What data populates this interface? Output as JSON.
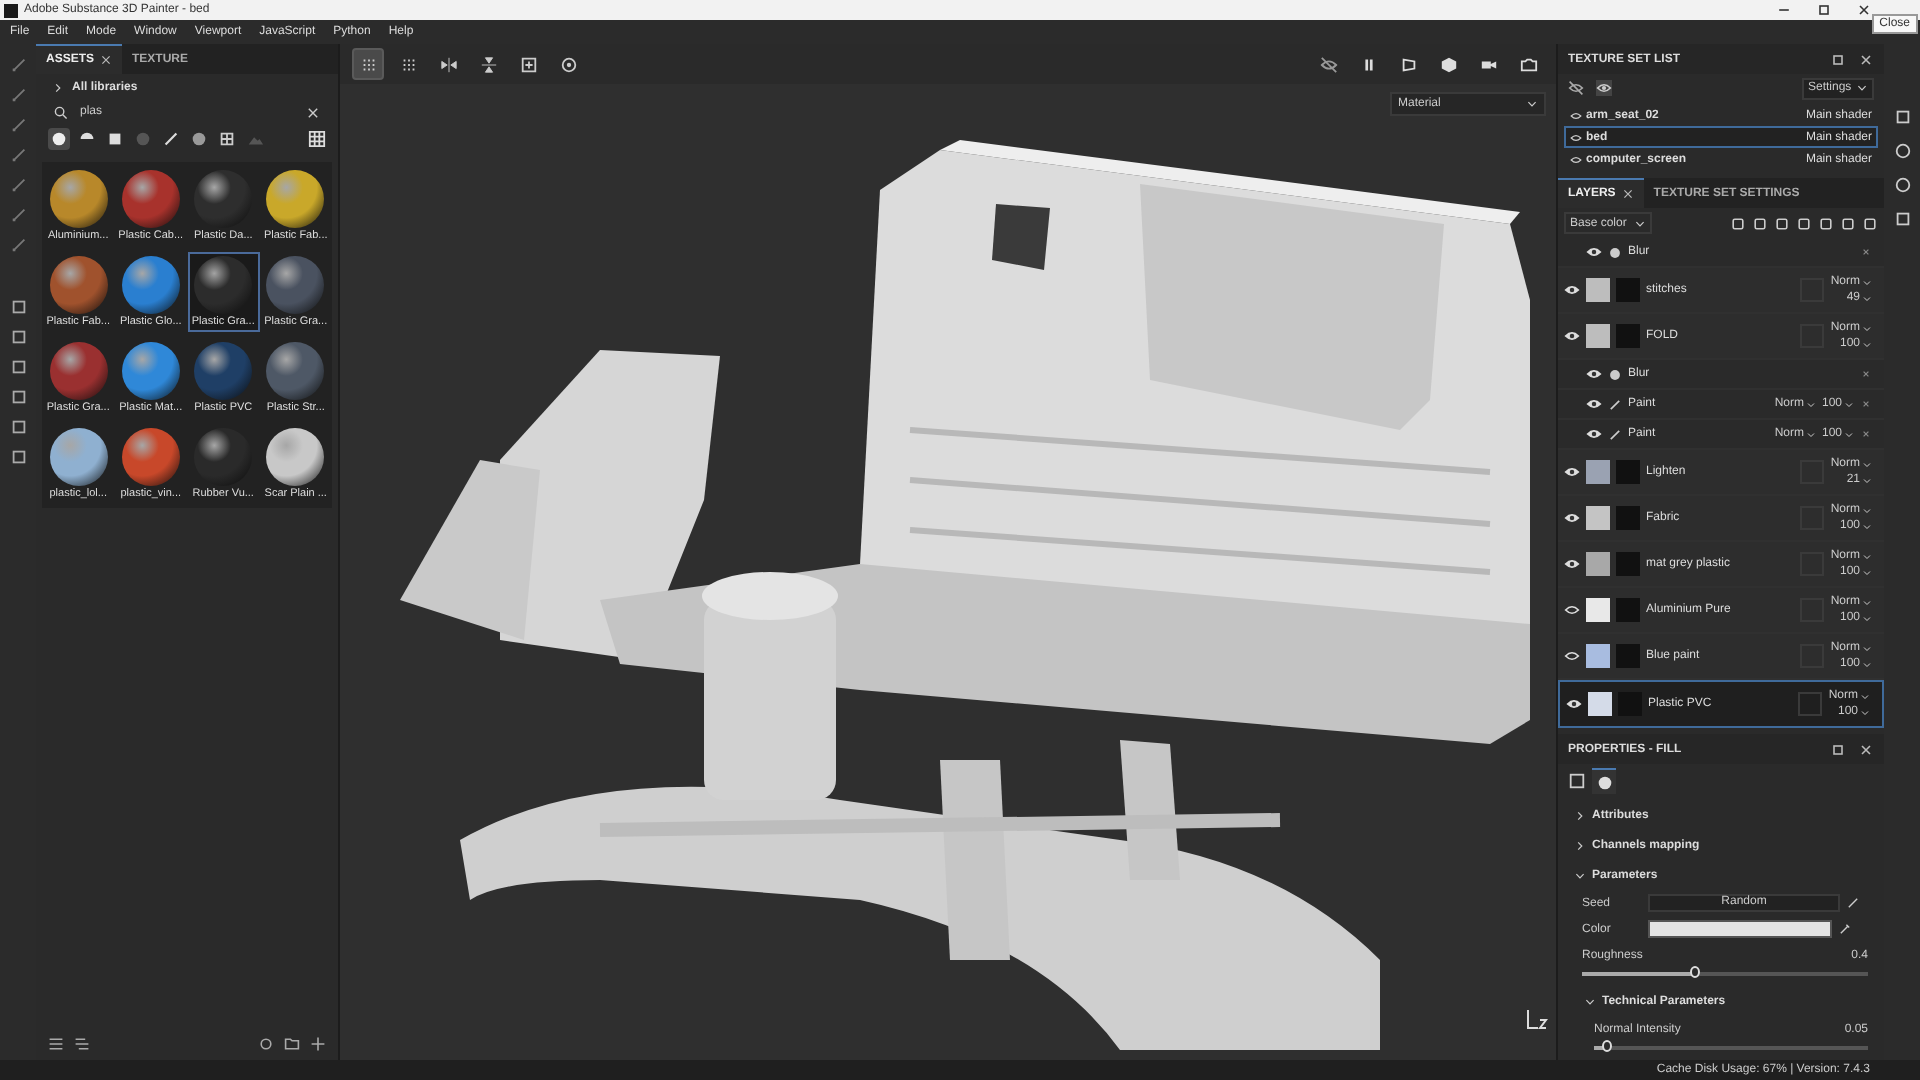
{
  "window": {
    "title": "Adobe Substance 3D Painter - bed",
    "tooltip": "Close"
  },
  "menu": [
    "File",
    "Edit",
    "Mode",
    "Window",
    "Viewport",
    "JavaScript",
    "Python",
    "Help"
  ],
  "assets": {
    "tabs": [
      {
        "label": "ASSETS",
        "selected": true
      },
      {
        "label": "TEXTURE",
        "selected": false
      }
    ],
    "breadcrumb": "All libraries",
    "search": {
      "value": "plas"
    },
    "filters": [
      {
        "kind": "sphere",
        "selected": true
      },
      {
        "kind": "half",
        "selected": false
      },
      {
        "kind": "square",
        "selected": false
      },
      {
        "kind": "dim",
        "selected": false
      },
      {
        "kind": "brush",
        "selected": false
      },
      {
        "kind": "dots",
        "selected": false
      },
      {
        "kind": "grid",
        "selected": false
      },
      {
        "kind": "image",
        "selected": false
      }
    ],
    "materials": [
      {
        "label": "Aluminium...",
        "color": "#b8882a",
        "selected": false
      },
      {
        "label": "Plastic Cab...",
        "color": "#a8322c",
        "selected": false
      },
      {
        "label": "Plastic Da...",
        "color": "#2e2e2e",
        "selected": false
      },
      {
        "label": "Plastic Fab...",
        "color": "#c9a82a",
        "selected": false
      },
      {
        "label": "Plastic Fab...",
        "color": "#a0522d",
        "selected": false
      },
      {
        "label": "Plastic Glo...",
        "color": "#2a7fd0",
        "selected": false
      },
      {
        "label": "Plastic Gra...",
        "color": "#2c2c2c",
        "selected": true
      },
      {
        "label": "Plastic Gra...",
        "color": "#4a5260",
        "selected": false
      },
      {
        "label": "Plastic Gra...",
        "color": "#9a3030",
        "selected": false
      },
      {
        "label": "Plastic Mat...",
        "color": "#2f88d8",
        "selected": false
      },
      {
        "label": "Plastic PVC",
        "color": "#1f3f66",
        "selected": false
      },
      {
        "label": "Plastic Str...",
        "color": "#4e5866",
        "selected": false
      },
      {
        "label": "plastic_lol...",
        "color": "#8fb0d0",
        "selected": false
      },
      {
        "label": "plastic_vin...",
        "color": "#c8482a",
        "selected": false
      },
      {
        "label": "Rubber Vu...",
        "color": "#2a2a2a",
        "selected": false
      },
      {
        "label": "Scar Plain ...",
        "color": "#c8c8c8",
        "selected": false
      }
    ]
  },
  "viewport": {
    "tools_left": [
      {
        "kind": "grid",
        "selected": true
      },
      {
        "kind": "grid-menu",
        "selected": false
      },
      {
        "kind": "mirror-x",
        "selected": false
      },
      {
        "kind": "mirror-y",
        "selected": false
      },
      {
        "kind": "frame",
        "selected": false
      },
      {
        "kind": "target",
        "selected": false
      }
    ],
    "tools_right": [
      {
        "kind": "hide",
        "selected": false
      },
      {
        "kind": "pause",
        "selected": false
      },
      {
        "kind": "view",
        "selected": false
      },
      {
        "kind": "cube",
        "selected": false
      },
      {
        "kind": "camera",
        "selected": false
      },
      {
        "kind": "photo",
        "selected": false
      }
    ],
    "mode_dropdown": "Material"
  },
  "texture_set_list": {
    "title": "TEXTURE SET LIST",
    "settings": "Settings",
    "rows": [
      {
        "name": "arm_seat_02",
        "shader": "Main shader",
        "selected": false
      },
      {
        "name": "bed",
        "shader": "Main shader",
        "selected": true
      },
      {
        "name": "computer_screen",
        "shader": "Main shader",
        "selected": false
      }
    ]
  },
  "layers": {
    "tabs": [
      {
        "label": "LAYERS",
        "selected": true
      },
      {
        "label": "TEXTURE SET SETTINGS",
        "selected": false
      }
    ],
    "channel": "Base color",
    "items": [
      {
        "kind": "effect",
        "name": "Blur",
        "visible": true
      },
      {
        "kind": "layer",
        "name": "stitches",
        "blend": "Norm",
        "opacity": "49",
        "visible": true,
        "color": "#bdbdbd",
        "selected": false
      },
      {
        "kind": "layer",
        "name": "FOLD",
        "blend": "Norm",
        "opacity": "100",
        "visible": true,
        "color": "#bdbdbd",
        "selected": false,
        "children": [
          {
            "kind": "effect",
            "name": "Blur",
            "visible": true
          },
          {
            "kind": "paint",
            "name": "Paint",
            "blend": "Norm",
            "opacity": "100",
            "visible": true
          },
          {
            "kind": "paint",
            "name": "Paint",
            "blend": "Norm",
            "opacity": "100",
            "visible": true
          }
        ]
      },
      {
        "kind": "layer",
        "name": "Lighten",
        "blend": "Norm",
        "opacity": "21",
        "visible": true,
        "color": "#9aa2b2",
        "selected": false
      },
      {
        "kind": "layer",
        "name": "Fabric",
        "blend": "Norm",
        "opacity": "100",
        "visible": true,
        "color": "#c4c4c4",
        "selected": false
      },
      {
        "kind": "layer",
        "name": "mat grey plastic",
        "blend": "Norm",
        "opacity": "100",
        "visible": true,
        "color": "#a8a8a8",
        "selected": false
      },
      {
        "kind": "layer",
        "name": "Aluminium Pure",
        "blend": "Norm",
        "opacity": "100",
        "visible": false,
        "color": "#e8e8e8",
        "selected": false
      },
      {
        "kind": "layer",
        "name": "Blue paint",
        "blend": "Norm",
        "opacity": "100",
        "visible": false,
        "color": "#a8bce0",
        "selected": false
      },
      {
        "kind": "layer",
        "name": "Plastic PVC",
        "blend": "Norm",
        "opacity": "100",
        "visible": true,
        "color": "#d4dbe8",
        "selected": true
      }
    ]
  },
  "properties": {
    "title": "PROPERTIES - FILL",
    "tabs": [
      {
        "kind": "layer",
        "selected": false
      },
      {
        "kind": "material",
        "selected": true
      }
    ],
    "sections": [
      {
        "label": "Attributes",
        "expanded": false
      },
      {
        "label": "Channels mapping",
        "expanded": false
      },
      {
        "label": "Parameters",
        "expanded": true,
        "params": [
          {
            "kind": "button",
            "label": "Seed",
            "value": "Random"
          },
          {
            "kind": "color",
            "label": "Color",
            "color": "#e4e4e4"
          },
          {
            "kind": "slider",
            "label": "Roughness",
            "reading": "0.4",
            "level": 0.4
          }
        ],
        "subsections": [
          {
            "label": "Technical Parameters",
            "expanded": true,
            "params": [
              {
                "kind": "slider",
                "label": "Normal Intensity",
                "reading": "0.05",
                "level": 0.05
              }
            ]
          }
        ]
      }
    ]
  },
  "status_bar": "Cache Disk Usage:  67% | Version: 7.4.3"
}
